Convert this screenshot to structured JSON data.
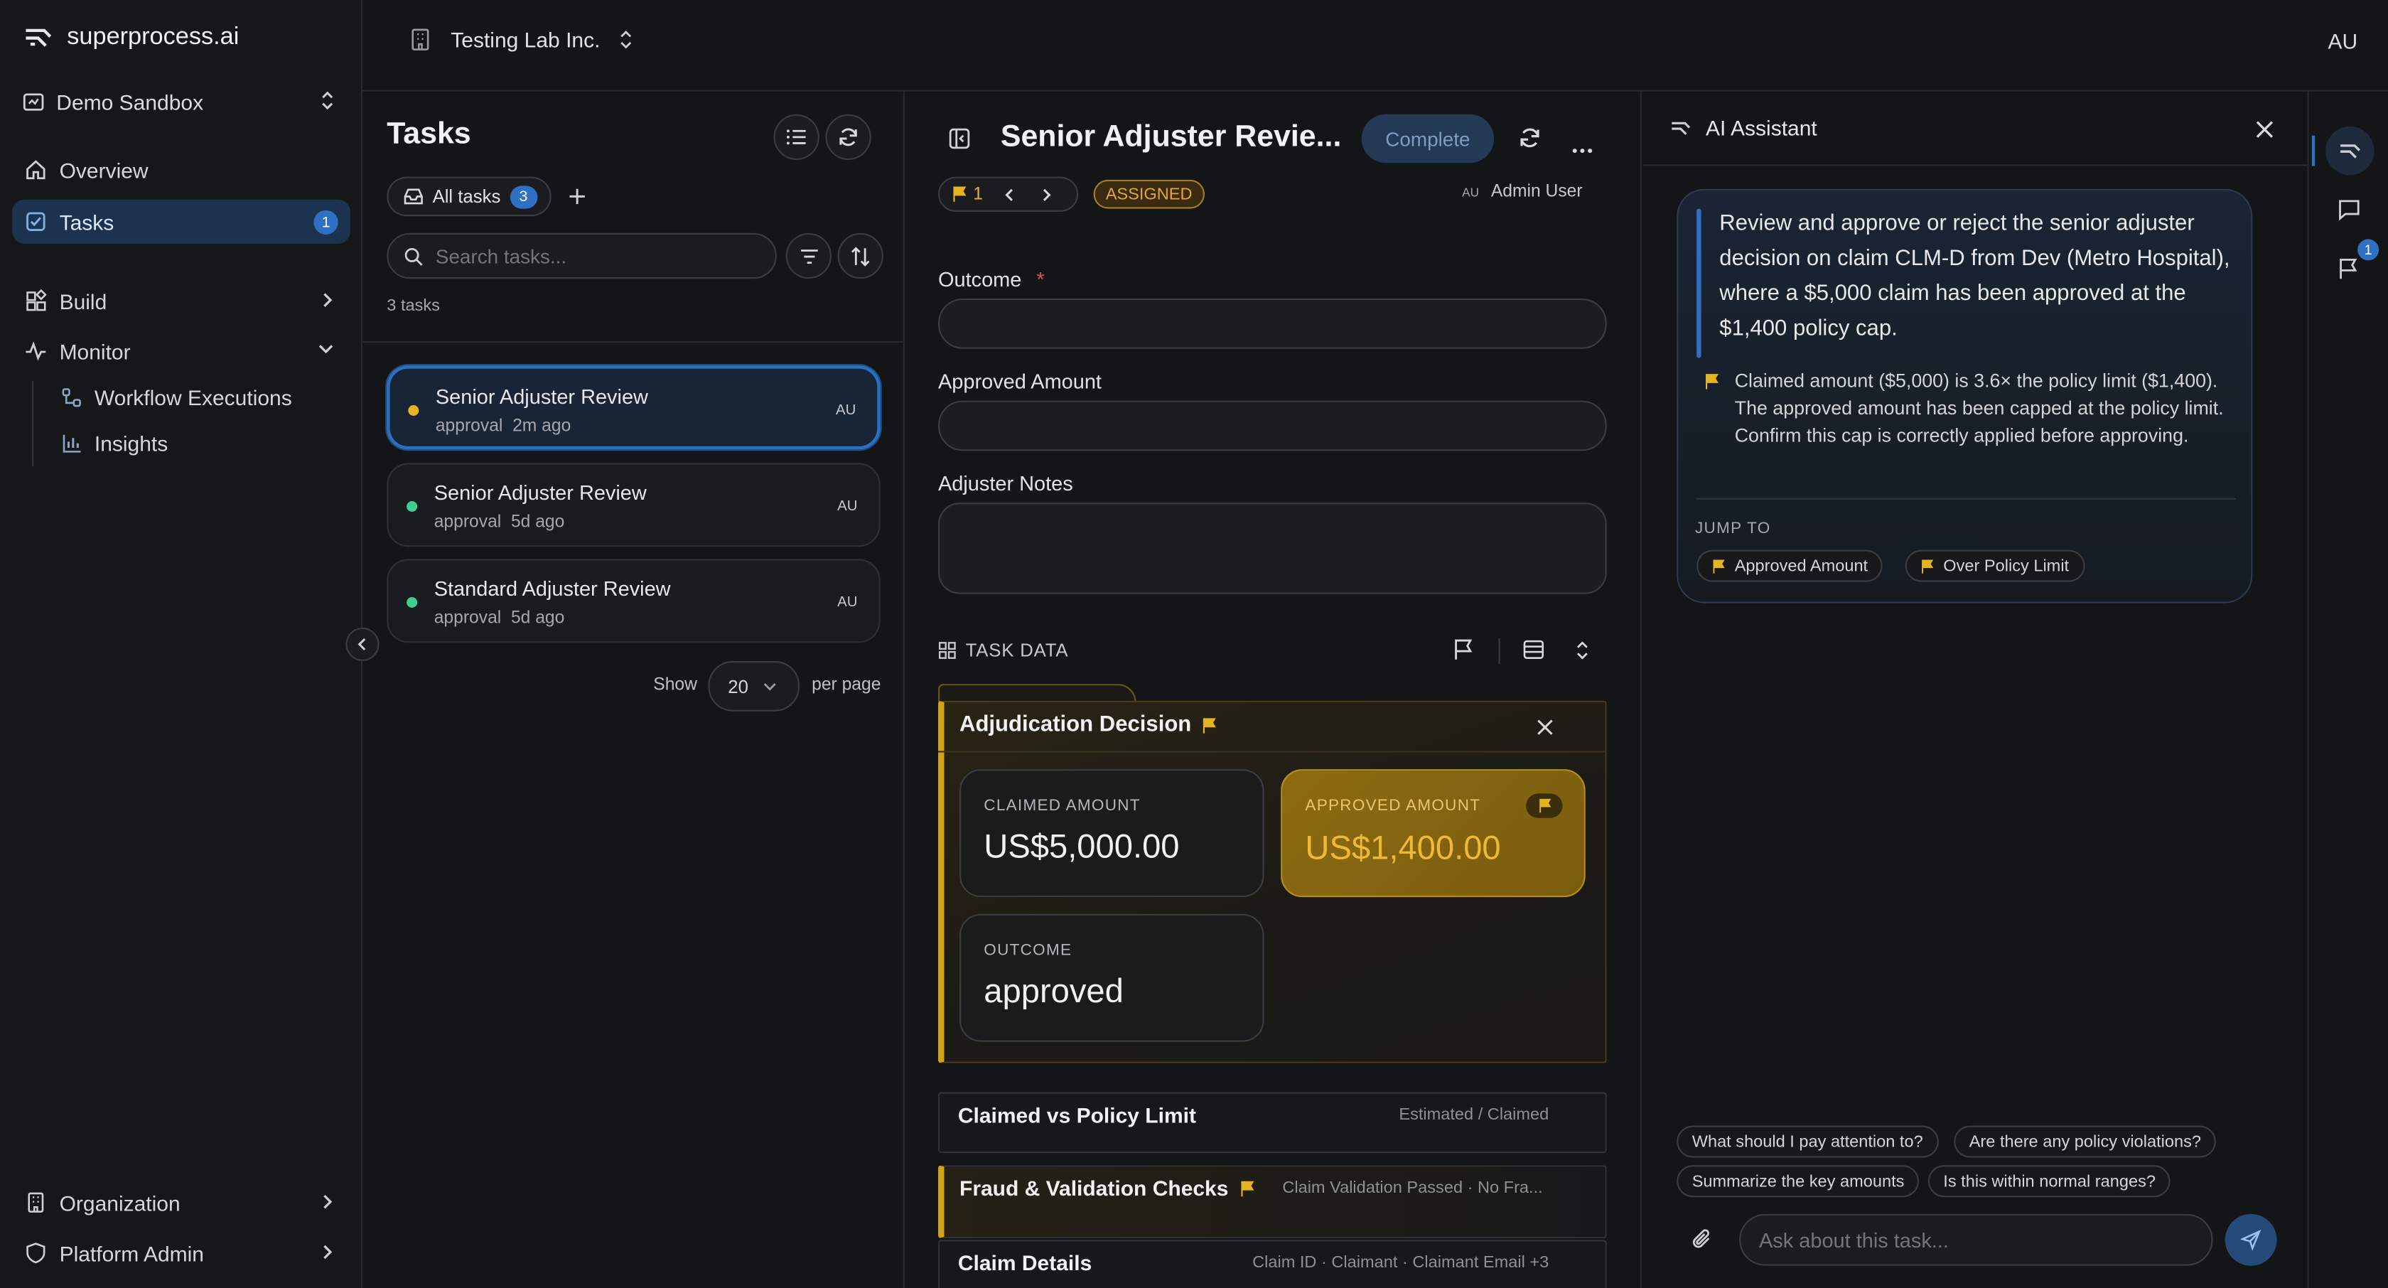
{
  "brand": {
    "name": "superprocess.ai"
  },
  "workspace": {
    "name": "Demo Sandbox"
  },
  "nav": {
    "overview": "Overview",
    "tasks": "Tasks",
    "tasks_badge": "1",
    "build": "Build",
    "monitor": "Monitor",
    "workflow_executions": "Workflow Executions",
    "insights": "Insights",
    "organization": "Organization",
    "platform_admin": "Platform Admin"
  },
  "topbar": {
    "org_name": "Testing Lab Inc.",
    "user_initials": "AU"
  },
  "tasks_panel": {
    "title": "Tasks",
    "filter_label": "All tasks",
    "filter_count": "3",
    "search_placeholder": "Search tasks...",
    "count_text": "3 tasks",
    "items": [
      {
        "title": "Senior Adjuster Review",
        "type": "approval",
        "time": "2m ago",
        "assignee": "AU",
        "status_color": "#e6b422"
      },
      {
        "title": "Senior Adjuster Review",
        "type": "approval",
        "time": "5d ago",
        "assignee": "AU",
        "status_color": "#3ecf8e"
      },
      {
        "title": "Standard Adjuster Review",
        "type": "approval",
        "time": "5d ago",
        "assignee": "AU",
        "status_color": "#3ecf8e"
      }
    ],
    "pagination": {
      "show_label": "Show",
      "page_size": "20",
      "per_page_label": "per page"
    }
  },
  "detail": {
    "title": "Senior Adjuster Revie...",
    "complete_label": "Complete",
    "flag_count": "1",
    "status": "ASSIGNED",
    "assignee_initials": "AU",
    "assignee_name": "Admin User",
    "fields": {
      "outcome_label": "Outcome",
      "required_mark": "*",
      "approved_amount_label": "Approved Amount",
      "adjuster_notes_label": "Adjuster Notes"
    },
    "task_data_label": "TASK DATA",
    "adjudication": {
      "title": "Adjudication Decision",
      "claimed_label": "CLAIMED AMOUNT",
      "claimed_value": "US$5,000.00",
      "approved_label": "APPROVED AMOUNT",
      "approved_value": "US$1,400.00",
      "outcome_label": "OUTCOME",
      "outcome_value": "approved"
    },
    "sections": [
      {
        "title": "Claimed vs Policy Limit",
        "meta": "Estimated / Claimed"
      },
      {
        "title": "Fraud & Validation Checks",
        "meta": "Claim Validation Passed · No Fra..."
      },
      {
        "title": "Claim Details",
        "meta": "Claim ID · Claimant · Claimant Email +3"
      }
    ]
  },
  "assistant": {
    "title": "AI Assistant",
    "summary": "Review and approve or reject the senior adjuster decision on claim CLM-D from Dev (Metro Hospital), where a $5,000 claim has been approved at the $1,400 policy cap.",
    "warning": "Claimed amount ($5,000) is 3.6× the policy limit ($1,400). The approved amount has been capped at the policy limit. Confirm this cap is correctly applied before approving.",
    "jump_to_label": "JUMP TO",
    "jump_links": [
      "Approved Amount",
      "Over Policy Limit"
    ],
    "suggestions": [
      "What should I pay attention to?",
      "Are there any policy violations?",
      "Summarize the key amounts",
      "Is this within normal ranges?"
    ],
    "input_placeholder": "Ask about this task..."
  },
  "rail": {
    "flag_badge": "1"
  },
  "colors": {
    "accent": "#2f6fc4",
    "flag": "#e6b422",
    "approved_card": "#8a6a12",
    "assigned": "#e2a63a"
  }
}
